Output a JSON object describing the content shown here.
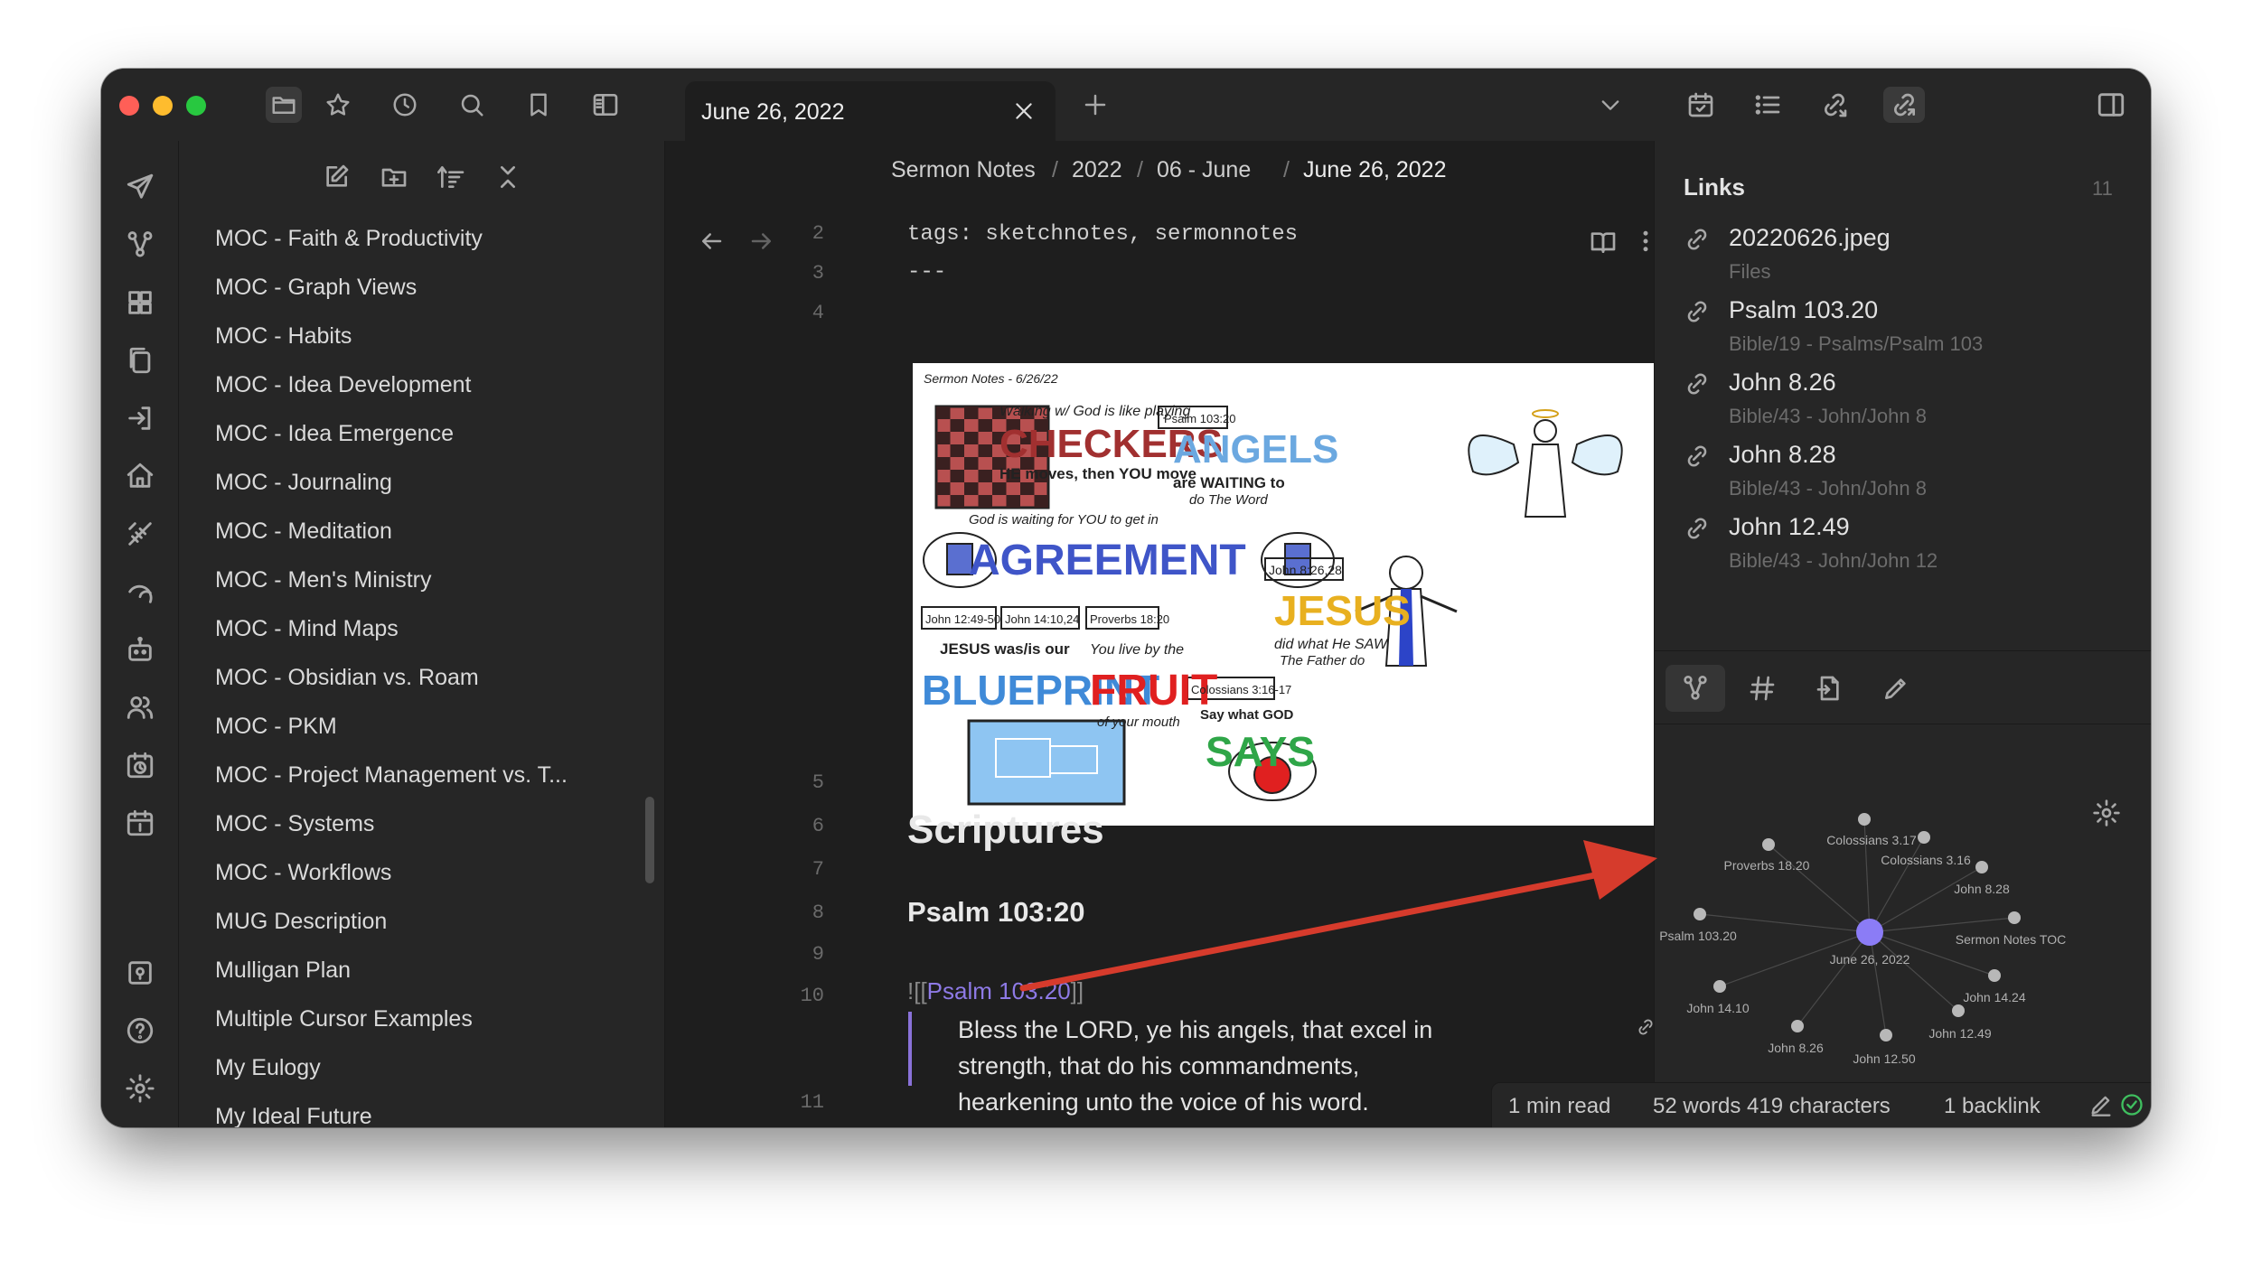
{
  "tab": {
    "title": "June 26, 2022"
  },
  "left_files": [
    "MOC - Faith & Productivity",
    "MOC - Graph Views",
    "MOC - Habits",
    "MOC - Idea Development",
    "MOC - Idea Emergence",
    "MOC - Journaling",
    "MOC - Meditation",
    "MOC - Men's Ministry",
    "MOC - Mind Maps",
    "MOC - Obsidian vs. Roam",
    "MOC - PKM",
    "MOC - Project Management vs. T...",
    "MOC - Systems",
    "MOC - Workflows",
    "MUG Description",
    "Mulligan Plan",
    "Multiple Cursor Examples",
    "My Eulogy",
    "My Ideal Future"
  ],
  "breadcrumb": {
    "c1": "Sermon Notes",
    "sep": "/",
    "c2": "2022",
    "c3": "06 - June",
    "c4": "June 26, 2022"
  },
  "editor": {
    "line_numbers": [
      "2",
      "3",
      "4",
      "5",
      "6",
      "7",
      "8",
      "9",
      "10",
      "11"
    ],
    "tags_line": "tags: sketchnotes, sermonnotes",
    "dash_line": "---",
    "heading": "Scriptures",
    "subheading": "Psalm 103:20",
    "embed_open": "![[",
    "embed_link": "Psalm 103.20",
    "embed_close": "]]",
    "quote": "Bless the LORD, ye his angels, that excel in strength, that do his commandments, hearkening unto the voice of his word."
  },
  "sketchnote": {
    "header": "Sermon Notes - 6/26/22",
    "walking": "Walking w/ God is like playing",
    "checkers": "CHECKERS",
    "he_moves": "HE moves, then YOU move",
    "psalm_ref": "Psalm 103:20",
    "angels": "ANGELS",
    "angels_sub": "are WAITING to",
    "angels_sub2": "do The Word",
    "god_waiting": "God is waiting for YOU to get in",
    "agreement": "AGREEMENT",
    "john_826": "John 8:26,28",
    "jesus": "JESUS",
    "did_what": "did what He SAW",
    "father": "The Father do",
    "john_1249": "John 12:49-50",
    "john_1410": "John 14:10,24",
    "proverbs": "Proverbs 18:20",
    "jesus_was": "JESUS was/is our",
    "you_live": "You live by the",
    "blueprint": "BLUEPRINT",
    "fruit": "FRUIT",
    "of_mouth": "of your mouth",
    "colossians": "Colossians 3:16-17",
    "say_what": "Say what GOD",
    "says": "SAYS"
  },
  "links_panel": {
    "title": "Links",
    "count": "11",
    "items": [
      {
        "name": "20220626.jpeg",
        "path": "Files"
      },
      {
        "name": "Psalm 103.20",
        "path": "Bible/19 - Psalms/Psalm 103"
      },
      {
        "name": "John 8.26",
        "path": "Bible/43 - John/John 8"
      },
      {
        "name": "John 8.28",
        "path": "Bible/43 - John/John 8"
      },
      {
        "name": "John 12.49",
        "path": "Bible/43 - John/John 12"
      }
    ]
  },
  "graph": {
    "center": "June 26, 2022",
    "nodes": [
      "Colossians 3.17",
      "Colossians 3.16",
      "Proverbs 18.20",
      "John 8.28",
      "Psalm 103.20",
      "Sermon Notes TOC",
      "John 14.24",
      "John 14.10",
      "John 12.49",
      "John 8.26",
      "John 12.50"
    ]
  },
  "status": {
    "read": "1 min read",
    "words": "52 words 419 characters",
    "backlinks": "1 backlink"
  },
  "colors": {
    "accent": "#8a72d9",
    "graph_center": "#8b7cf6",
    "arrow": "#d63b2c",
    "close": "#ff5f57",
    "minimize": "#febc2e",
    "maximize": "#28c840"
  }
}
